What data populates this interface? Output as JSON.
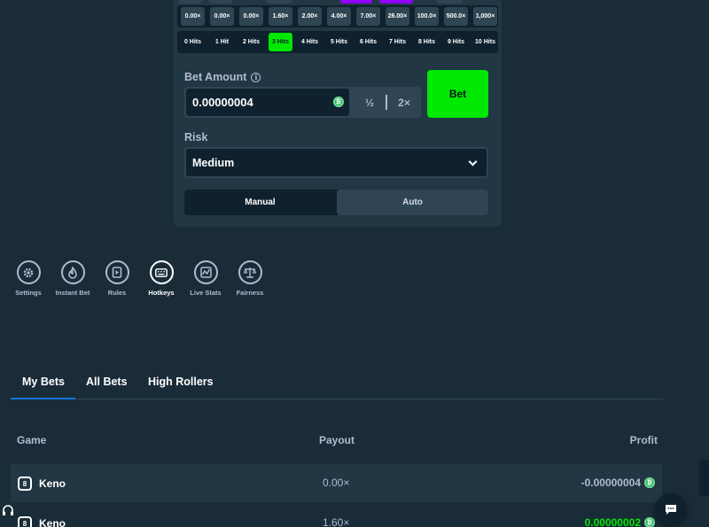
{
  "colors": {
    "background": "#1a2c38",
    "panel": "#213743",
    "accent_green": "#00e701",
    "tab_underline": "#1475e1",
    "remnant_purple": "#9000ff"
  },
  "payouts": [
    "0.00×",
    "0.00×",
    "0.00×",
    "1.60×",
    "2.00×",
    "4.00×",
    "7.00×",
    "26.00×",
    "100.0×",
    "500.0×",
    "1,000×"
  ],
  "hits": [
    "0 Hits",
    "1 Hit",
    "2 Hits",
    "3 Hits",
    "4 Hits",
    "5 Hits",
    "6 Hits",
    "7 Hits",
    "8 Hits",
    "9 Hits",
    "10 Hits"
  ],
  "selected_hits_index": 3,
  "bet": {
    "label": "Bet Amount",
    "info_icon": "info-icon",
    "amount": "0.00000004",
    "half_label": "½",
    "double_label": "2×",
    "bet_button_label": "Bet",
    "coin_icon": "bitcoin-icon"
  },
  "risk": {
    "label": "Risk",
    "value": "Medium"
  },
  "mode": {
    "manual": "Manual",
    "auto": "Auto",
    "selected": "Manual"
  },
  "tools": [
    {
      "label": "Settings",
      "icon": "gear-icon"
    },
    {
      "label": "Instant Bet",
      "icon": "flame-icon"
    },
    {
      "label": "Rules",
      "icon": "book-icon"
    },
    {
      "label": "Hotkeys",
      "icon": "keyboard-icon"
    },
    {
      "label": "Live Stats",
      "icon": "stats-icon"
    },
    {
      "label": "Fairness",
      "icon": "scales-icon"
    }
  ],
  "active_tool": "Hotkeys",
  "bets_tabs": [
    "My Bets",
    "All Bets",
    "High Rollers"
  ],
  "active_bets_tab": "My Bets",
  "table": {
    "headers": {
      "game": "Game",
      "payout": "Payout",
      "profit": "Profit"
    },
    "rows": [
      {
        "game": "Keno",
        "payout": "0.00×",
        "profit": "-0.00000004",
        "profit_color": "#b1bad3"
      },
      {
        "game": "Keno",
        "payout": "1.60×",
        "profit": "0.00000002",
        "profit_color": "#00e701"
      }
    ]
  }
}
